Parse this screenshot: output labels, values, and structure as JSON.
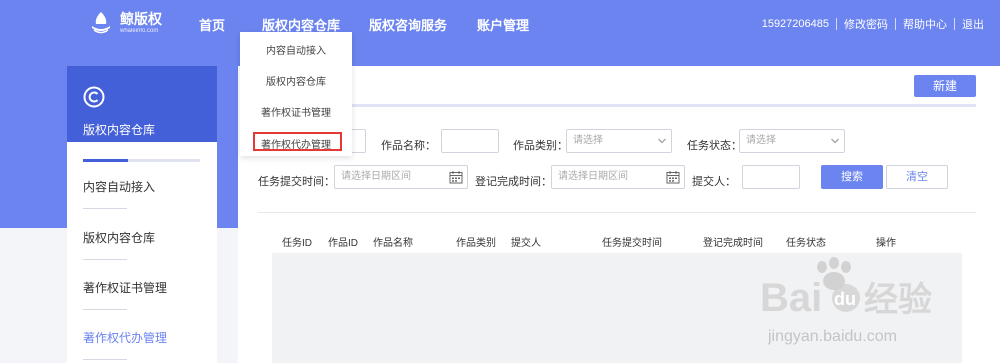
{
  "brand": {
    "name": "鲸版权",
    "sub": "whaleinfo.com"
  },
  "nav": {
    "home": "首页",
    "repo": "版权内容仓库",
    "consult": "版权咨询服务",
    "account": "账户管理"
  },
  "user": {
    "phone": "15927206485",
    "change_password": "修改密码",
    "help": "帮助中心",
    "logout": "退出"
  },
  "dropdown": {
    "items": [
      "内容自动接入",
      "版权内容仓库",
      "著作权证书管理",
      "著作权代办管理"
    ],
    "highlighted_index": 3,
    "highlight_color": "#e53935"
  },
  "sidebar": {
    "title": "版权内容仓库",
    "items": [
      "内容自动接入",
      "版权内容仓库",
      "著作权证书管理",
      "著作权代办管理"
    ],
    "active_index": 3
  },
  "main": {
    "new_button": "新建"
  },
  "filters": {
    "work_name_label": "作品名称：",
    "work_type_label": "作品类别：",
    "work_type_placeholder": "请选择",
    "task_status_label": "任务状态：",
    "task_status_placeholder": "请选择",
    "submit_time_label": "任务提交时间：",
    "submit_time_placeholder": "请选择日期区间",
    "complete_time_label": "登记完成时间：",
    "complete_time_placeholder": "请选择日期区间",
    "submitter_label": "提交人：",
    "search_button": "搜索",
    "clear_button": "清空"
  },
  "table": {
    "columns": [
      "任务ID",
      "作品ID",
      "作品名称",
      "作品类别",
      "提交人",
      "任务提交时间",
      "登记完成时间",
      "任务状态",
      "操作"
    ]
  },
  "watermark": {
    "text": "经验",
    "url": "jingyan.baidu.com"
  },
  "colors": {
    "primary": "#6b84f0",
    "sidebar_head": "#4460d8",
    "highlight": "#e53935"
  }
}
